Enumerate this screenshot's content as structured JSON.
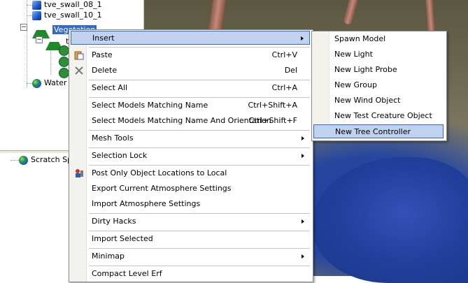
{
  "tree": {
    "items": [
      {
        "label": "tve_swall_08_1",
        "icon": "cube-icon"
      },
      {
        "label": "tve_swall_10_1",
        "icon": "cube-icon"
      },
      {
        "label": "Vegetation",
        "icon": "tree-icon",
        "selected": true
      },
      {
        "label": "tre",
        "icon": "tree-icon"
      },
      {
        "label": "Water",
        "icon": "globe-icon"
      }
    ],
    "expander_minus": "−"
  },
  "scratch": {
    "label": "Scratch Sp",
    "icon": "globe-icon"
  },
  "context_menu": {
    "items": [
      {
        "label": "Insert",
        "shortcut": "",
        "submenu": true,
        "highlighted": true
      },
      {
        "label": "Paste",
        "shortcut": "Ctrl+V",
        "icon": "paste-icon"
      },
      {
        "label": "Delete",
        "shortcut": "Del",
        "icon": "delete-icon"
      },
      {
        "label": "Select All",
        "shortcut": "Ctrl+A"
      },
      {
        "label": "Select Models Matching Name",
        "shortcut": "Ctrl+Shift+A"
      },
      {
        "label": "Select Models Matching Name And Orientation",
        "shortcut": "Ctrl+Shift+F"
      },
      {
        "label": "Mesh Tools",
        "shortcut": "",
        "submenu": true
      },
      {
        "label": "Selection Lock",
        "shortcut": "",
        "submenu": true
      },
      {
        "label": "Post Only Object Locations to Local",
        "shortcut": "",
        "icon": "post-icon"
      },
      {
        "label": "Export Current Atmosphere Settings",
        "shortcut": ""
      },
      {
        "label": "Import Atmosphere Settings",
        "shortcut": ""
      },
      {
        "label": "Dirty Hacks",
        "shortcut": "",
        "submenu": true
      },
      {
        "label": "Import Selected",
        "shortcut": ""
      },
      {
        "label": "Minimap",
        "shortcut": "",
        "submenu": true
      },
      {
        "label": "Compact Level Erf",
        "shortcut": ""
      }
    ]
  },
  "submenu": {
    "items": [
      {
        "label": "Spawn Model"
      },
      {
        "label": "New Light"
      },
      {
        "label": "New Light Probe"
      },
      {
        "label": "New Group"
      },
      {
        "label": "New Wind Object"
      },
      {
        "label": "New Test Creature Object"
      },
      {
        "label": "New Tree Controller",
        "highlighted": true
      }
    ]
  },
  "colors": {
    "selection": "#316ac5",
    "menu_highlight": "#c1d2ee",
    "water": "#21409c"
  }
}
